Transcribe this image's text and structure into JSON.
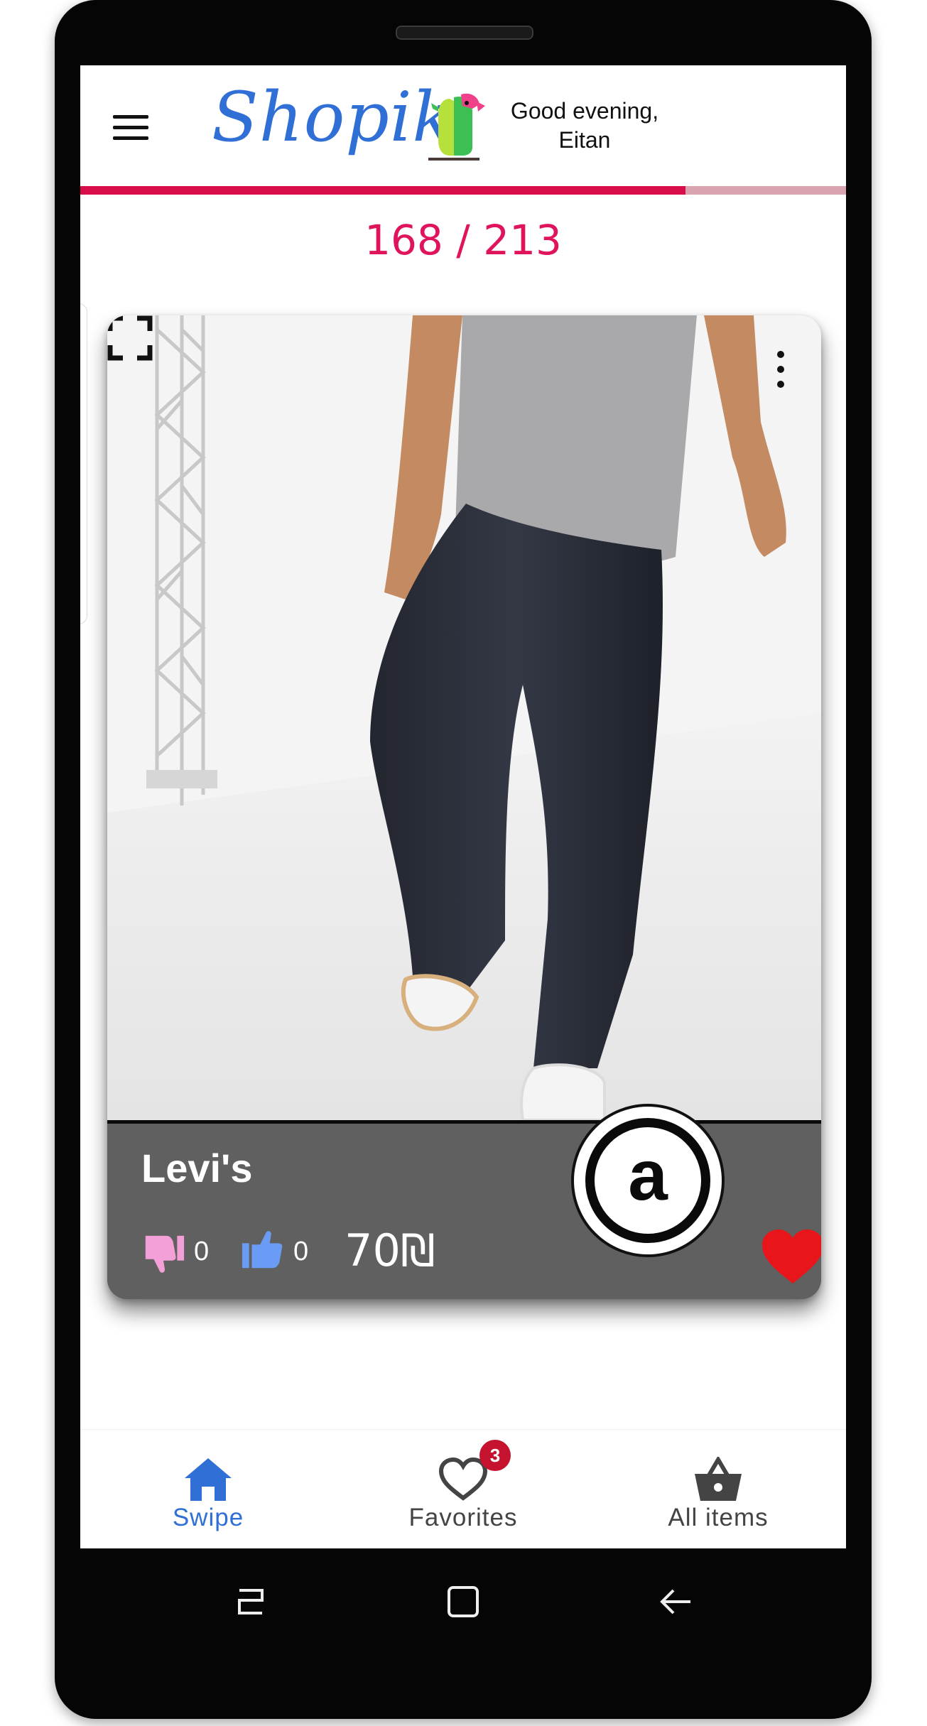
{
  "header": {
    "logo": "Shopik",
    "greeting_line1": "Good evening,",
    "greeting_line2": "Eitan"
  },
  "progress": {
    "current": 168,
    "total": 213,
    "fraction": 0.79,
    "label": "168 / 213"
  },
  "product": {
    "brand": "Levi's",
    "brand_logo_letter": "a",
    "dislikes": "0",
    "likes": "0",
    "price": "70₪",
    "favorited": true
  },
  "bottom_nav": {
    "items": [
      {
        "label": "Swipe",
        "icon": "home-icon",
        "active": true
      },
      {
        "label": "Favorites",
        "icon": "heart-outline-icon",
        "badge": "3"
      },
      {
        "label": "All items",
        "icon": "basket-icon"
      }
    ]
  },
  "colors": {
    "accent_pink": "#e0135d",
    "progress_track": "#d9a3b0",
    "brand_blue": "#2f6fd6",
    "card_gray": "#606060",
    "favorite_red": "#e8161b",
    "badge_red": "#c4122f"
  },
  "system_nav": [
    "recents-icon",
    "home-square-icon",
    "back-icon"
  ]
}
